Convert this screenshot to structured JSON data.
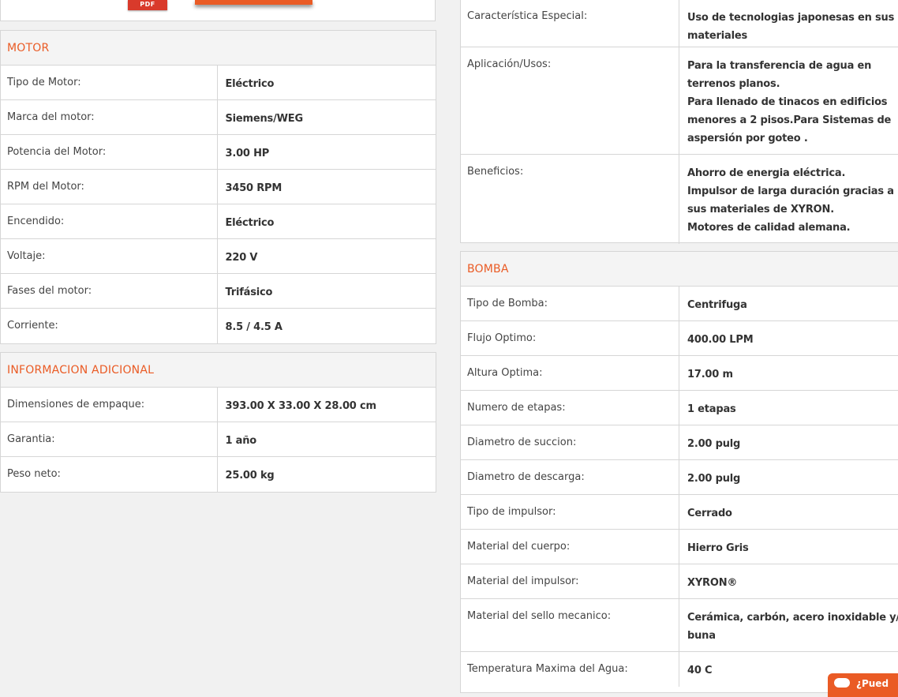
{
  "top": {
    "pdf_label": "PDF"
  },
  "motor": {
    "title": "MOTOR",
    "rows": [
      {
        "label": "Tipo de Motor:",
        "value": "Eléctrico"
      },
      {
        "label": "Marca del motor:",
        "value": "Siemens/WEG"
      },
      {
        "label": "Potencia del Motor:",
        "value": "3.00 HP"
      },
      {
        "label": "RPM del Motor:",
        "value": "3450 RPM"
      },
      {
        "label": "Encendido:",
        "value": "Eléctrico"
      },
      {
        "label": "Voltaje:",
        "value": "220 V"
      },
      {
        "label": "Fases del motor:",
        "value": "Trifásico"
      },
      {
        "label": "Corriente:",
        "value": "8.5 / 4.5 A"
      }
    ]
  },
  "info": {
    "title": "INFORMACION ADICIONAL",
    "rows": [
      {
        "label": "Dimensiones de empaque:",
        "value": "393.00 X 33.00 X 28.00 cm"
      },
      {
        "label": "Garantia:",
        "value": "1 año"
      },
      {
        "label": "Peso neto:",
        "value": "25.00 kg"
      }
    ]
  },
  "general": {
    "rows": [
      {
        "label": "Característica Especial:",
        "lines": [
          "Uso de tecnologias japonesas en sus",
          "materiales"
        ]
      },
      {
        "label": "Aplicación/Usos:",
        "lines": [
          "Para la transferencia de agua en",
          "terrenos planos.",
          "Para llenado de tinacos en edificios",
          "menores a 2 pisos.Para Sistemas de",
          "aspersión por goteo ."
        ]
      },
      {
        "label": "Beneficios:",
        "lines": [
          "Ahorro de energia eléctrica.",
          "Impulsor de larga duración gracias a",
          "sus materiales de XYRON.",
          "Motores de calidad alemana."
        ]
      }
    ]
  },
  "bomba": {
    "title": "BOMBA",
    "rows": [
      {
        "label": "Tipo de Bomba:",
        "lines": [
          "Centrifuga"
        ]
      },
      {
        "label": "Flujo Optimo:",
        "lines": [
          "400.00 LPM"
        ]
      },
      {
        "label": "Altura Optima:",
        "lines": [
          "17.00 m"
        ]
      },
      {
        "label": "Numero de etapas:",
        "lines": [
          "1 etapas"
        ]
      },
      {
        "label": "Diametro de succion:",
        "lines": [
          "2.00 pulg"
        ]
      },
      {
        "label": "Diametro de descarga:",
        "lines": [
          "2.00 pulg"
        ]
      },
      {
        "label": "Tipo de impulsor:",
        "lines": [
          "Cerrado"
        ]
      },
      {
        "label": "Material del cuerpo:",
        "lines": [
          "Hierro Gris"
        ]
      },
      {
        "label": "Material del impulsor:",
        "lines": [
          "XYRON®"
        ]
      },
      {
        "label": "Material del sello mecanico:",
        "lines": [
          "Cerámica, carbón, acero inoxidable y/o",
          "buna"
        ]
      },
      {
        "label": "Temperatura Maxima del Agua:",
        "lines": [
          "40 C"
        ]
      }
    ]
  },
  "chat": {
    "label": "¿Pued"
  },
  "colors": {
    "accent": "#ea5b25",
    "border": "#d6d6d6",
    "background": "#f1f1f1"
  }
}
